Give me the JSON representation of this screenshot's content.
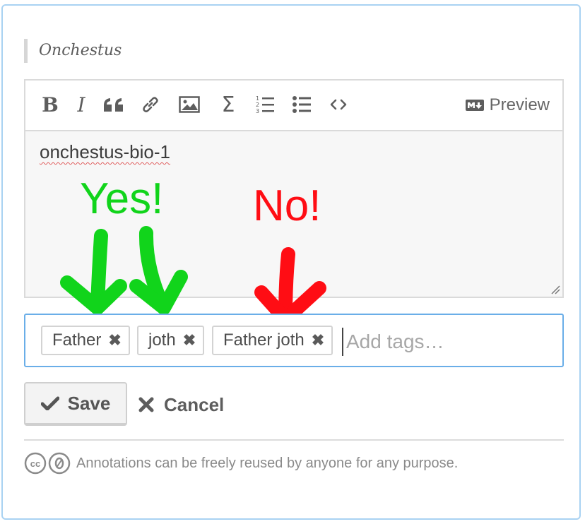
{
  "quote": {
    "text": "Onchestus"
  },
  "toolbar": {
    "buttons": [
      {
        "name": "bold-icon"
      },
      {
        "name": "italic-icon"
      },
      {
        "name": "quote-icon"
      },
      {
        "name": "link-icon"
      },
      {
        "name": "image-icon"
      },
      {
        "name": "math-icon"
      },
      {
        "name": "numbered-list-icon"
      },
      {
        "name": "bulleted-list-icon"
      },
      {
        "name": "code-icon"
      }
    ],
    "preview_label": "Preview",
    "preview_icon": "markdown-icon"
  },
  "editor": {
    "text": "onchestus-bio-1"
  },
  "annotations": {
    "yes": "Yes!",
    "no": "No!",
    "yes_color": "#11d41b",
    "no_color": "#ff0d14"
  },
  "tags": {
    "items": [
      {
        "label": "Father"
      },
      {
        "label": "joth"
      },
      {
        "label": "Father joth"
      }
    ],
    "remove_glyph": "✖",
    "placeholder": "Add tags…"
  },
  "actions": {
    "save_label": "Save",
    "cancel_label": "Cancel"
  },
  "footer": {
    "text": "Annotations can be freely reused by anyone for any purpose.",
    "icon": "creative-commons-icon"
  },
  "colors": {
    "focus_border": "#6aaee8",
    "card_border": "#a9d2f2"
  }
}
